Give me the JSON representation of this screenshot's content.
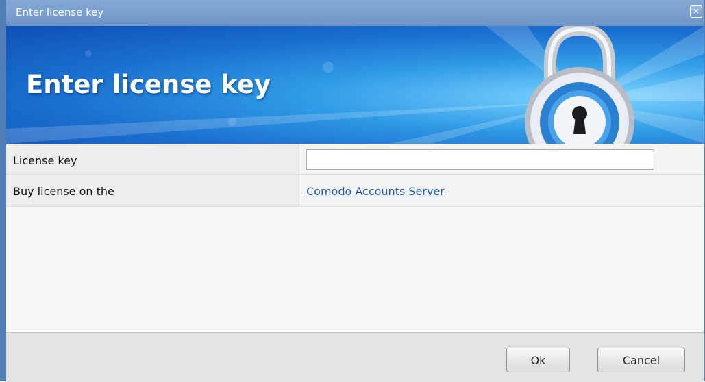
{
  "window": {
    "title": "Enter license key",
    "close_glyph": "×"
  },
  "banner": {
    "heading": "Enter license key",
    "icon": "padlock-icon"
  },
  "form": {
    "license_key_label": "License key",
    "license_key_value": "",
    "buy_label": "Buy license on the",
    "buy_link": "Comodo Accounts Server"
  },
  "footer": {
    "ok_label": "Ok",
    "cancel_label": "Cancel"
  },
  "colors": {
    "titlebar": "#6e94c6",
    "banner_blue": "#1a6fcf",
    "link": "#1f56a8"
  }
}
